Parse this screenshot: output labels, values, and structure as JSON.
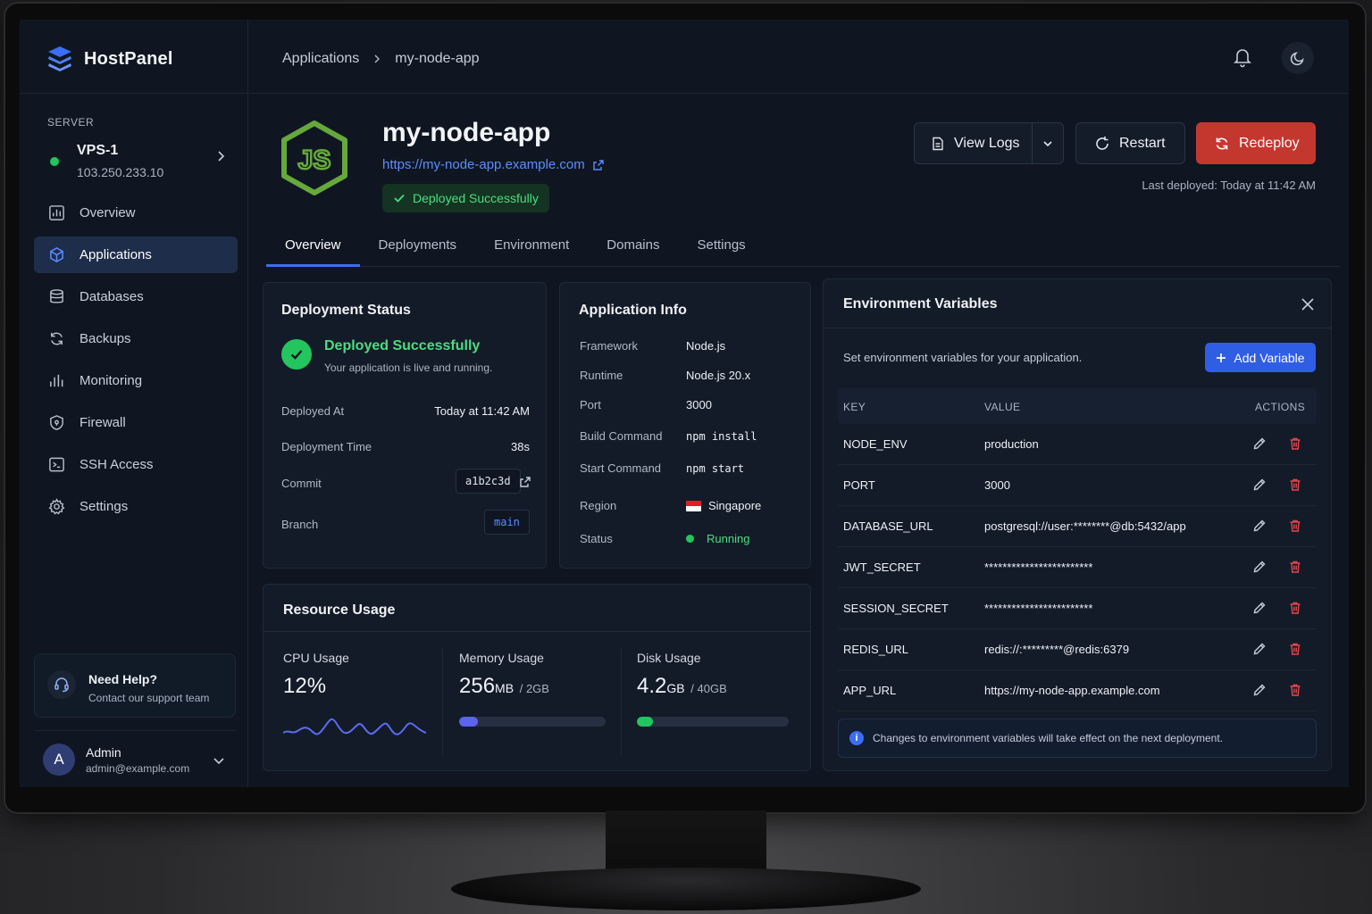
{
  "brand": {
    "name": "HostPanel"
  },
  "server": {
    "caption": "SERVER",
    "name": "VPS-1",
    "ip": "103.250.233.10",
    "status_color": "#22c55e"
  },
  "nav": [
    {
      "label": "Overview",
      "icon": "grid-chart-icon"
    },
    {
      "label": "Applications",
      "icon": "cube-icon",
      "active": true
    },
    {
      "label": "Databases",
      "icon": "database-icon"
    },
    {
      "label": "Backups",
      "icon": "refresh-icon"
    },
    {
      "label": "Monitoring",
      "icon": "bar-chart-icon"
    },
    {
      "label": "Firewall",
      "icon": "shield-icon"
    },
    {
      "label": "SSH Access",
      "icon": "terminal-icon"
    },
    {
      "label": "Settings",
      "icon": "gear-icon"
    }
  ],
  "help": {
    "title": "Need Help?",
    "subtitle": "Contact our support team",
    "icon": "headset-icon"
  },
  "user": {
    "initial": "A",
    "name": "Admin",
    "email": "admin@example.com"
  },
  "breadcrumb": {
    "parent": "Applications",
    "current": "my-node-app"
  },
  "app": {
    "name": "my-node-app",
    "url": "https://my-node-app.example.com",
    "badge": "Deployed Successfully",
    "logo_text": "JS"
  },
  "actions": {
    "view_logs": "View Logs",
    "restart": "Restart",
    "redeploy": "Redeploy",
    "last_deployed": "Last deployed: Today at 11:42 AM"
  },
  "tabs": [
    "Overview",
    "Deployments",
    "Environment",
    "Domains",
    "Settings"
  ],
  "deployment_status": {
    "title": "Deployment Status",
    "status_title": "Deployed Successfully",
    "status_sub": "Your application is live and running.",
    "deployed_at_label": "Deployed At",
    "deployed_at": "Today at 11:42 AM",
    "time_label": "Deployment Time",
    "time": "38s",
    "commit_label": "Commit",
    "commit": "a1b2c3d",
    "branch_label": "Branch",
    "branch": "main"
  },
  "app_info": {
    "title": "Application Info",
    "rows": [
      {
        "label": "Framework",
        "value": "Node.js"
      },
      {
        "label": "Runtime",
        "value": "Node.js 20.x"
      },
      {
        "label": "Port",
        "value": "3000"
      },
      {
        "label": "Build Command",
        "value": "npm install"
      },
      {
        "label": "Start Command",
        "value": "npm start"
      },
      {
        "label": "Region",
        "value": "Singapore"
      },
      {
        "label": "Status",
        "value": "Running"
      }
    ]
  },
  "resources": {
    "title": "Resource Usage",
    "cpu": {
      "label": "CPU Usage",
      "value": "12%"
    },
    "memory": {
      "label": "Memory Usage",
      "value": "256",
      "unit": "MB",
      "total": "/ 2GB",
      "fraction": 0.125,
      "color": "#5b63f0"
    },
    "disk": {
      "label": "Disk Usage",
      "value": "4.2",
      "unit": "GB",
      "total": "/ 40GB",
      "fraction": 0.105,
      "color": "#22c55e"
    }
  },
  "env": {
    "title": "Environment Variables",
    "description": "Set environment variables for your application.",
    "add_label": "Add Variable",
    "headers": {
      "key": "KEY",
      "value": "VALUE",
      "actions": "ACTIONS"
    },
    "rows": [
      {
        "key": "NODE_ENV",
        "value": "production"
      },
      {
        "key": "PORT",
        "value": "3000"
      },
      {
        "key": "DATABASE_URL",
        "value": "postgresql://user:********@db:5432/app"
      },
      {
        "key": "JWT_SECRET",
        "value": "************************"
      },
      {
        "key": "SESSION_SECRET",
        "value": "************************"
      },
      {
        "key": "REDIS_URL",
        "value": "redis://:*********@redis:6379"
      },
      {
        "key": "APP_URL",
        "value": "https://my-node-app.example.com"
      }
    ],
    "note": "Changes to environment variables will take effect on the next deployment."
  }
}
